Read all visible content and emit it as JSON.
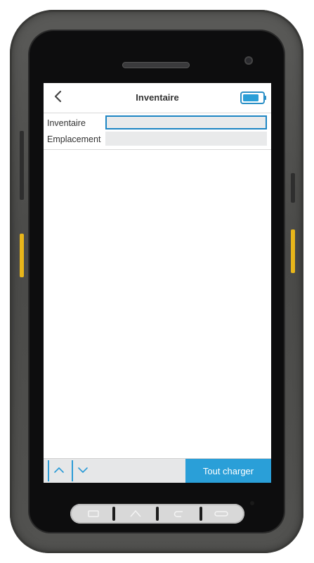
{
  "header": {
    "title": "Inventaire",
    "back_icon": "chevron-left-icon",
    "battery_icon": "battery-icon"
  },
  "form": {
    "fields": [
      {
        "label": "Inventaire",
        "value": "",
        "focused": true
      },
      {
        "label": "Emplacement",
        "value": "",
        "focused": false
      }
    ]
  },
  "toolbar": {
    "up_icon": "chevron-up-icon",
    "down_icon": "chevron-down-icon",
    "load_all_label": "Tout charger"
  },
  "hardware_nav": {
    "keys": [
      "menu-icon",
      "home-icon",
      "back-icon",
      "recent-apps-icon"
    ]
  },
  "colors": {
    "accent": "#2a9fd8",
    "focus_border": "#1e86c4",
    "input_bg": "#e9eaeb",
    "device_body": "#4e4e4c",
    "side_button_yellow": "#e8b61a"
  }
}
